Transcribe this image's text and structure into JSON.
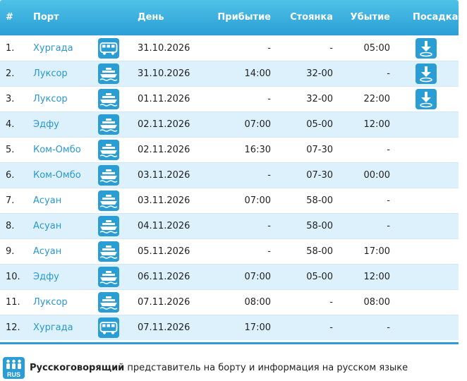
{
  "header": {
    "num": "#",
    "port": "Порт",
    "day": "День",
    "arrival": "Прибытие",
    "stay": "Стоянка",
    "departure": "Убытие",
    "boarding": "Посадка"
  },
  "rows": [
    {
      "num": "1.",
      "port": "Хургада",
      "icon": "bus-icon",
      "day": "31.10.2026",
      "arrival": "-",
      "stay": "-",
      "departure": "05:00",
      "boarding": true
    },
    {
      "num": "2.",
      "port": "Луксор",
      "icon": "ship-icon",
      "day": "31.10.2026",
      "arrival": "14:00",
      "stay": "32-00",
      "departure": "-",
      "boarding": true
    },
    {
      "num": "3.",
      "port": "Луксор",
      "icon": "ship-icon",
      "day": "01.11.2026",
      "arrival": "-",
      "stay": "32-00",
      "departure": "22:00",
      "boarding": true
    },
    {
      "num": "4.",
      "port": "Эдфу",
      "icon": "ship-icon",
      "day": "02.11.2026",
      "arrival": "07:00",
      "stay": "05-00",
      "departure": "12:00",
      "boarding": false
    },
    {
      "num": "5.",
      "port": "Ком-Омбо",
      "icon": "ship-icon",
      "day": "02.11.2026",
      "arrival": "16:30",
      "stay": "07-30",
      "departure": "-",
      "boarding": false
    },
    {
      "num": "6.",
      "port": "Ком-Омбо",
      "icon": "ship-icon",
      "day": "03.11.2026",
      "arrival": "-",
      "stay": "07-30",
      "departure": "00:00",
      "boarding": false
    },
    {
      "num": "7.",
      "port": "Асуан",
      "icon": "ship-icon",
      "day": "03.11.2026",
      "arrival": "07:00",
      "stay": "58-00",
      "departure": "-",
      "boarding": false
    },
    {
      "num": "8.",
      "port": "Асуан",
      "icon": "ship-icon",
      "day": "04.11.2026",
      "arrival": "-",
      "stay": "58-00",
      "departure": "-",
      "boarding": false
    },
    {
      "num": "9.",
      "port": "Асуан",
      "icon": "ship-icon",
      "day": "05.11.2026",
      "arrival": "-",
      "stay": "58-00",
      "departure": "17:00",
      "boarding": false
    },
    {
      "num": "10.",
      "port": "Эдфу",
      "icon": "ship-icon",
      "day": "06.11.2026",
      "arrival": "07:00",
      "stay": "05-00",
      "departure": "12:00",
      "boarding": false
    },
    {
      "num": "11.",
      "port": "Луксор",
      "icon": "ship-icon",
      "day": "07.11.2026",
      "arrival": "08:00",
      "stay": "-",
      "departure": "08:00",
      "boarding": false
    },
    {
      "num": "12.",
      "port": "Хургада",
      "icon": "bus-icon",
      "day": "07.11.2026",
      "arrival": "17:00",
      "stay": "-",
      "departure": "-",
      "boarding": false
    }
  ],
  "legend": {
    "badge": "RUS",
    "bold": "Русскоговорящий",
    "text": " представитель на борту и информация на русском языке"
  },
  "colors": {
    "header_top": "#4fc2e8",
    "header_bottom": "#2a9ed4",
    "row_alt": "#dcf1fb",
    "port_link": "#2a97cf",
    "icon_blue": "#2a9ed4"
  }
}
